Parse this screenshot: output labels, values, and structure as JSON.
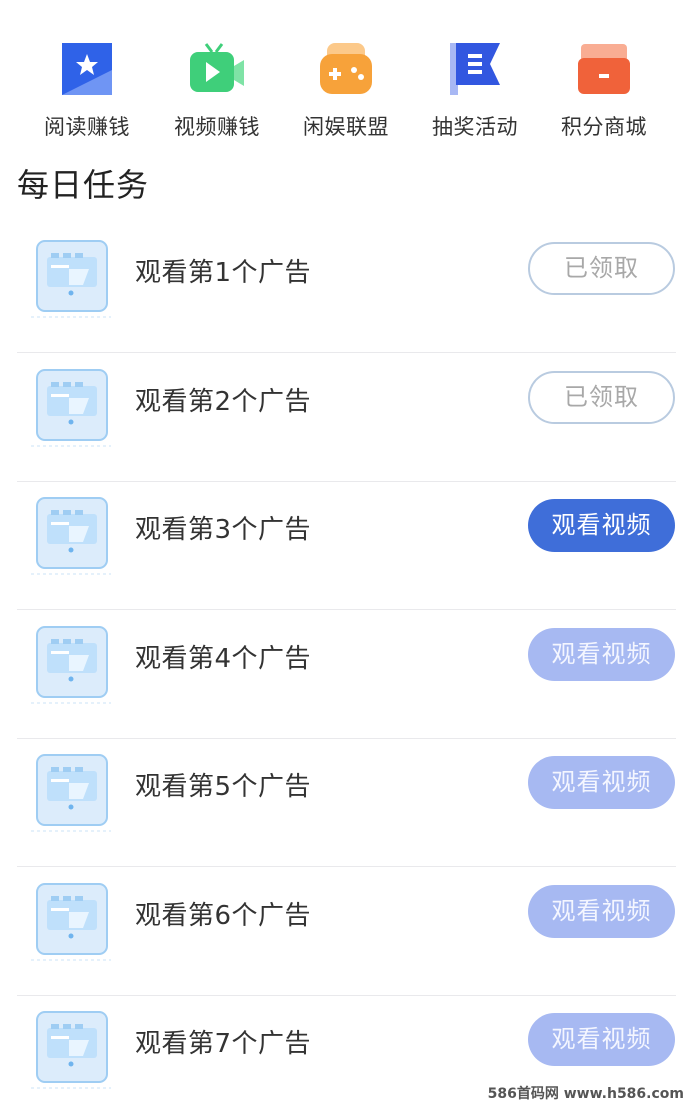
{
  "shortcuts": [
    {
      "label": "阅读赚钱",
      "icon": "book-star-icon",
      "color": "#2f62e8"
    },
    {
      "label": "视频赚钱",
      "icon": "video-camera-icon",
      "color": "#3fcf7a"
    },
    {
      "label": "闲娱联盟",
      "icon": "gamepad-icon",
      "color": "#f7a23a"
    },
    {
      "label": "抽奖活动",
      "icon": "flag-list-icon",
      "color": "#3257e0"
    },
    {
      "label": "积分商城",
      "icon": "gift-box-icon",
      "color": "#f0623a"
    }
  ],
  "section_title": "每日任务",
  "tasks": [
    {
      "label": "观看第1个广告",
      "button": "已领取",
      "state": "claimed"
    },
    {
      "label": "观看第2个广告",
      "button": "已领取",
      "state": "claimed"
    },
    {
      "label": "观看第3个广告",
      "button": "观看视频",
      "state": "active"
    },
    {
      "label": "观看第4个广告",
      "button": "观看视频",
      "state": "disabled"
    },
    {
      "label": "观看第5个广告",
      "button": "观看视频",
      "state": "disabled"
    },
    {
      "label": "观看第6个广告",
      "button": "观看视频",
      "state": "disabled"
    },
    {
      "label": "观看第7个广告",
      "button": "观看视频",
      "state": "disabled"
    }
  ],
  "watermark": "586首码网 www.h586.com"
}
